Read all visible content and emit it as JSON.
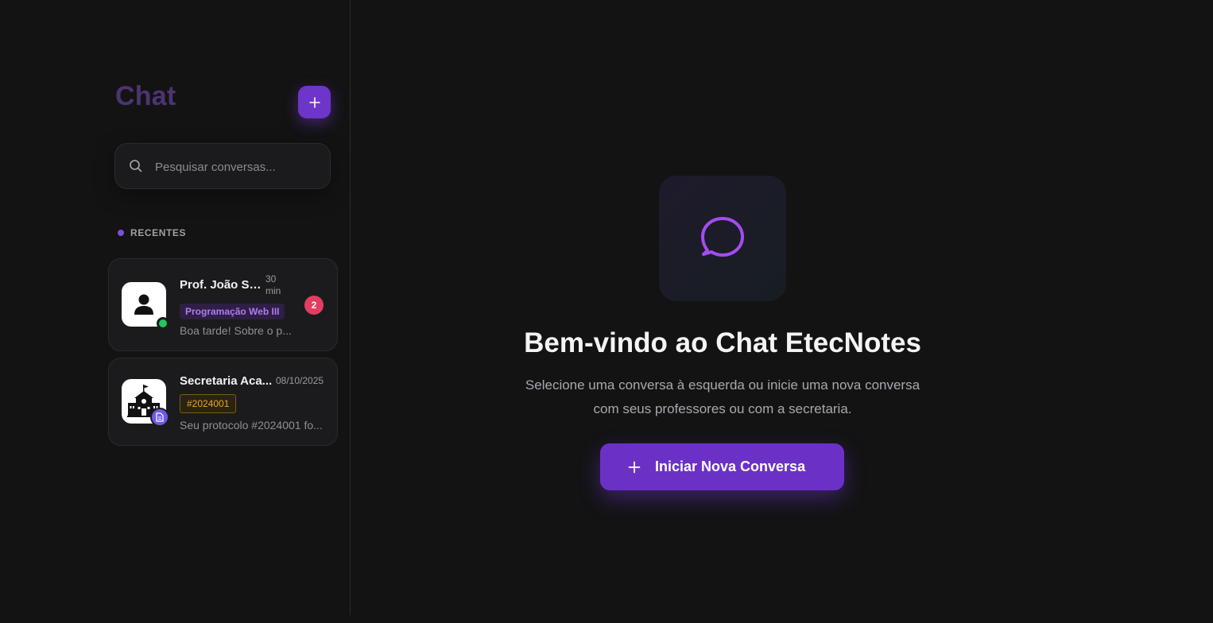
{
  "sidebar": {
    "title": "Chat",
    "new_chat_icon": "plus-icon",
    "search": {
      "placeholder": "Pesquisar conversas...",
      "value": ""
    },
    "section_label": "RECENTES",
    "conversations": [
      {
        "name": "Prof. João Sa...",
        "time": "30 min",
        "tag": "Programação Web III",
        "preview": "Boa tarde! Sobre o p...",
        "unread": "2",
        "status": "online",
        "avatar_icon": "user-icon"
      },
      {
        "name": "Secretaria Aca...",
        "time": "08/10/2025",
        "tag": "#2024001",
        "preview": "Seu protocolo #2024001 fo...",
        "avatar_icon": "school-building-icon",
        "badge_icon": "document-icon"
      }
    ]
  },
  "main": {
    "icon": "chat-bubble-icon",
    "title": "Bem-vindo ao Chat EtecNotes",
    "subtitle": "Selecione uma conversa à esquerda ou inicie uma nova conversa com seus professores ou com a secretaria.",
    "cta_label": "Iniciar Nova Conversa"
  },
  "colors": {
    "accent": "#6b31c7",
    "background": "#131313",
    "card": "#1b1b1d",
    "online": "#22c55e",
    "unread": "#e43d62",
    "protocol_tag": "#e8a919"
  }
}
